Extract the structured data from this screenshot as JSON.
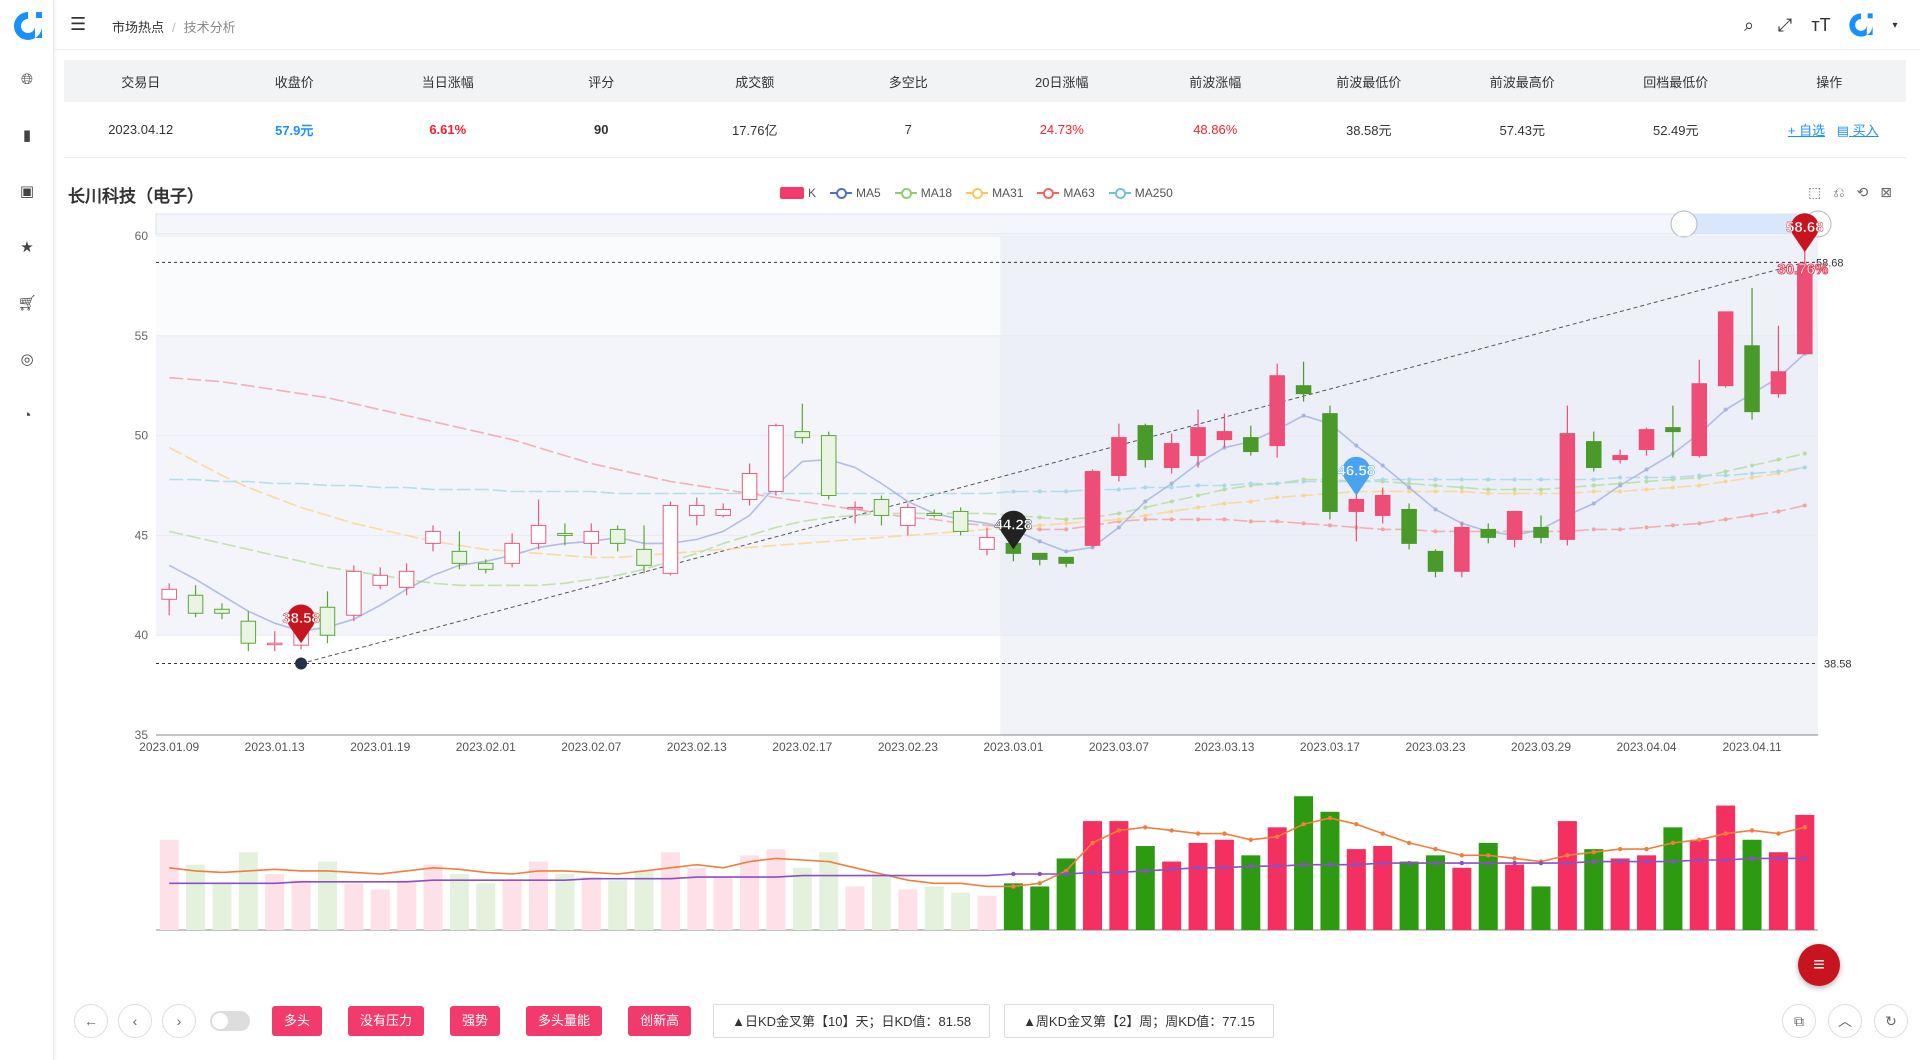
{
  "breadcrumb": {
    "root": "市场热点",
    "current": "技术分析"
  },
  "table": {
    "headers": [
      "交易日",
      "收盘价",
      "当日涨幅",
      "评分",
      "成交额",
      "多空比",
      "20日涨幅",
      "前波涨幅",
      "前波最低价",
      "前波最高价",
      "回档最低价",
      "操作"
    ],
    "row": [
      "2023.04.12",
      "57.9元",
      "6.61%",
      "90",
      "17.76亿",
      "7",
      "24.73%",
      "48.86%",
      "38.58元",
      "57.43元",
      "52.49元"
    ],
    "actions": {
      "watch": "+ 自选",
      "buy": "买入"
    }
  },
  "stock_title": "长川科技（电子）",
  "legend": [
    {
      "name": "K",
      "color": "#f23b6c"
    },
    {
      "name": "MA5",
      "color": "#5470c6"
    },
    {
      "name": "MA18",
      "color": "#91cc75"
    },
    {
      "name": "MA31",
      "color": "#fac858"
    },
    {
      "name": "MA63",
      "color": "#ee6666"
    },
    {
      "name": "MA250",
      "color": "#73c0de"
    }
  ],
  "chart_data": {
    "type": "candlestick",
    "ylim": [
      35,
      60
    ],
    "yticks": [
      "60",
      "55",
      "50",
      "45",
      "40",
      "35"
    ],
    "xticks": [
      "2023.01.09",
      "2023.01.13",
      "2023.01.19",
      "2023.02.01",
      "2023.02.07",
      "2023.02.13",
      "2023.02.17",
      "2023.02.23",
      "2023.03.01",
      "2023.03.07",
      "2023.03.13",
      "2023.03.17",
      "2023.03.23",
      "2023.03.29",
      "2023.04.04",
      "2023.04.11"
    ],
    "candles": [
      [
        41.8,
        42.3,
        41.0,
        42.6
      ],
      [
        42.0,
        41.1,
        40.9,
        42.5
      ],
      [
        41.3,
        41.1,
        40.8,
        41.6
      ],
      [
        40.7,
        39.6,
        39.2,
        41.2
      ],
      [
        39.6,
        39.6,
        39.2,
        40.2
      ],
      [
        39.5,
        40.8,
        39.3,
        41.3
      ],
      [
        41.4,
        40.0,
        39.6,
        42.2
      ],
      [
        41.0,
        43.2,
        40.7,
        43.5
      ],
      [
        42.5,
        43.0,
        42.3,
        43.4
      ],
      [
        42.4,
        43.2,
        42.0,
        43.6
      ],
      [
        44.6,
        45.2,
        44.2,
        45.5
      ],
      [
        44.2,
        43.6,
        43.3,
        45.2
      ],
      [
        43.6,
        43.3,
        43.1,
        43.8
      ],
      [
        43.6,
        44.6,
        43.4,
        45.1
      ],
      [
        44.6,
        45.5,
        44.3,
        46.8
      ],
      [
        45.1,
        45.0,
        44.5,
        45.6
      ],
      [
        44.6,
        45.2,
        44.0,
        45.6
      ],
      [
        45.3,
        44.6,
        44.2,
        45.5
      ],
      [
        44.3,
        43.5,
        43.1,
        45.5
      ],
      [
        43.1,
        46.5,
        43.0,
        46.7
      ],
      [
        46.0,
        46.5,
        45.5,
        46.9
      ],
      [
        46.0,
        46.3,
        45.9,
        46.6
      ],
      [
        46.8,
        48.1,
        46.5,
        48.6
      ],
      [
        47.2,
        50.5,
        47.0,
        50.6
      ],
      [
        50.2,
        49.9,
        49.6,
        51.6
      ],
      [
        50.0,
        47.0,
        46.8,
        50.2
      ],
      [
        46.4,
        46.4,
        45.6,
        46.7
      ],
      [
        46.8,
        46.0,
        45.5,
        47.0
      ],
      [
        45.5,
        46.4,
        45.0,
        46.6
      ],
      [
        46.1,
        46.0,
        45.9,
        46.3
      ],
      [
        46.2,
        45.2,
        45.0,
        46.4
      ],
      [
        44.3,
        44.9,
        44.0,
        45.4
      ],
      [
        44.6,
        44.1,
        43.7,
        44.6
      ],
      [
        44.1,
        43.8,
        43.5,
        44.1
      ],
      [
        43.9,
        43.6,
        43.4,
        43.9
      ],
      [
        44.5,
        48.2,
        44.4,
        48.3
      ],
      [
        48.0,
        49.9,
        47.7,
        50.6
      ],
      [
        50.5,
        48.8,
        48.4,
        50.6
      ],
      [
        48.4,
        49.6,
        48.1,
        50.1
      ],
      [
        49.0,
        50.4,
        48.4,
        51.3
      ],
      [
        49.8,
        50.2,
        49.4,
        51.1
      ],
      [
        49.9,
        49.2,
        49.0,
        50.5
      ],
      [
        49.5,
        53.0,
        48.9,
        53.6
      ],
      [
        52.5,
        52.1,
        51.7,
        53.7
      ],
      [
        51.1,
        46.2,
        45.8,
        51.5
      ],
      [
        46.2,
        46.8,
        44.7,
        47.1
      ],
      [
        46.0,
        47.0,
        45.6,
        47.4
      ],
      [
        46.3,
        44.6,
        44.3,
        46.6
      ],
      [
        44.2,
        43.2,
        42.9,
        44.3
      ],
      [
        43.2,
        45.4,
        42.9,
        45.6
      ],
      [
        45.3,
        44.9,
        44.6,
        45.6
      ],
      [
        44.8,
        46.2,
        44.4,
        46.2
      ],
      [
        45.4,
        44.9,
        44.6,
        46.0
      ],
      [
        44.8,
        50.1,
        44.5,
        51.5
      ],
      [
        49.7,
        48.4,
        48.2,
        50.2
      ],
      [
        48.8,
        49.0,
        48.6,
        49.3
      ],
      [
        49.3,
        50.3,
        49.0,
        50.4
      ],
      [
        50.4,
        50.2,
        48.9,
        51.5
      ],
      [
        49.0,
        52.6,
        48.9,
        53.8
      ],
      [
        52.5,
        56.2,
        52.4,
        56.2
      ],
      [
        54.5,
        51.2,
        50.8,
        57.4
      ],
      [
        52.1,
        53.2,
        51.9,
        55.5
      ],
      [
        54.1,
        58.5,
        54.1,
        60.0
      ]
    ],
    "ma5": [
      43.5,
      42.8,
      42.0,
      41.2,
      40.6,
      40.2,
      40.4,
      40.8,
      41.5,
      42.3,
      43.0,
      43.5,
      43.7,
      44.0,
      44.4,
      44.6,
      44.7,
      44.9,
      44.6,
      44.6,
      44.8,
      45.2,
      46.0,
      47.5,
      48.7,
      48.8,
      48.4,
      47.6,
      46.7,
      46.1,
      45.8,
      45.6,
      45.3,
      44.7,
      44.2,
      44.4,
      45.4,
      46.7,
      47.6,
      48.6,
      49.4,
      49.7,
      50.3,
      51.0,
      50.6,
      49.5,
      48.5,
      47.4,
      46.3,
      45.6,
      45.2,
      45.0,
      45.3,
      46.0,
      46.6,
      47.5,
      48.3,
      49.1,
      50.1,
      51.3,
      52.1,
      52.9,
      54.1
    ],
    "ma18": [
      45.2,
      44.9,
      44.6,
      44.3,
      44.0,
      43.7,
      43.4,
      43.2,
      43.0,
      42.8,
      42.6,
      42.5,
      42.5,
      42.5,
      42.5,
      42.6,
      42.8,
      43.0,
      43.3,
      43.7,
      44.1,
      44.6,
      45.0,
      45.4,
      45.7,
      45.9,
      46.0,
      46.1,
      46.1,
      46.1,
      46.1,
      46.1,
      46.0,
      45.9,
      45.8,
      45.9,
      46.1,
      46.4,
      46.7,
      47.0,
      47.3,
      47.5,
      47.6,
      47.8,
      47.8,
      47.7,
      47.7,
      47.6,
      47.5,
      47.4,
      47.3,
      47.3,
      47.3,
      47.4,
      47.5,
      47.6,
      47.7,
      47.8,
      47.9,
      48.2,
      48.5,
      48.8,
      49.1
    ],
    "ma31": [
      49.4,
      48.7,
      48.0,
      47.4,
      46.9,
      46.4,
      46.0,
      45.6,
      45.3,
      45.0,
      44.7,
      44.5,
      44.3,
      44.2,
      44.1,
      44.0,
      43.9,
      43.9,
      44.0,
      44.1,
      44.2,
      44.3,
      44.4,
      44.5,
      44.6,
      44.7,
      44.8,
      44.9,
      45.0,
      45.1,
      45.2,
      45.3,
      45.4,
      45.5,
      45.6,
      45.7,
      45.8,
      46.0,
      46.2,
      46.4,
      46.6,
      46.7,
      46.9,
      47.0,
      47.1,
      47.2,
      47.2,
      47.2,
      47.2,
      47.2,
      47.1,
      47.1,
      47.1,
      47.1,
      47.2,
      47.2,
      47.3,
      47.4,
      47.5,
      47.7,
      47.9,
      48.1,
      48.4
    ],
    "ma63": [
      52.9,
      52.8,
      52.7,
      52.5,
      52.3,
      52.1,
      51.9,
      51.6,
      51.3,
      51.0,
      50.7,
      50.4,
      50.1,
      49.8,
      49.4,
      49.0,
      48.6,
      48.3,
      48.0,
      47.7,
      47.5,
      47.3,
      47.1,
      46.9,
      46.7,
      46.5,
      46.3,
      46.1,
      45.9,
      45.8,
      45.6,
      45.5,
      45.4,
      45.3,
      45.3,
      45.5,
      45.7,
      45.8,
      45.8,
      45.8,
      45.8,
      45.7,
      45.7,
      45.6,
      45.5,
      45.4,
      45.3,
      45.3,
      45.2,
      45.2,
      45.2,
      45.2,
      45.2,
      45.2,
      45.3,
      45.3,
      45.4,
      45.5,
      45.6,
      45.8,
      46.0,
      46.2,
      46.5
    ],
    "ma250": [
      47.8,
      47.8,
      47.7,
      47.7,
      47.6,
      47.6,
      47.5,
      47.5,
      47.4,
      47.4,
      47.3,
      47.3,
      47.3,
      47.2,
      47.2,
      47.2,
      47.2,
      47.1,
      47.1,
      47.1,
      47.1,
      47.1,
      47.1,
      47.1,
      47.1,
      47.1,
      47.1,
      47.1,
      47.1,
      47.1,
      47.1,
      47.1,
      47.2,
      47.2,
      47.2,
      47.3,
      47.3,
      47.4,
      47.4,
      47.5,
      47.5,
      47.6,
      47.6,
      47.7,
      47.7,
      47.7,
      47.8,
      47.8,
      47.8,
      47.8,
      47.8,
      47.8,
      47.8,
      47.8,
      47.8,
      47.9,
      47.9,
      47.9,
      48.0,
      48.0,
      48.1,
      48.2,
      48.4
    ],
    "annotations": {
      "low_label": "38.58",
      "high_label": "58.68",
      "high_pct": "30.76%",
      "mid_label": "44.28",
      "peak_label": "46.58",
      "right_low": "38.58",
      "right_high": "58.68"
    },
    "volume": [
      58,
      42,
      30,
      50,
      36,
      32,
      44,
      30,
      26,
      32,
      42,
      36,
      30,
      32,
      44,
      36,
      34,
      32,
      38,
      50,
      40,
      34,
      48,
      52,
      40,
      50,
      28,
      36,
      26,
      28,
      24,
      22,
      30,
      28,
      46,
      70,
      70,
      54,
      44,
      56,
      58,
      48,
      66,
      86,
      76,
      52,
      54,
      44,
      48,
      40,
      56,
      42,
      28,
      70,
      52,
      46,
      48,
      66,
      58,
      80,
      58,
      50,
      74
    ],
    "vol_ma1": [
      40,
      38,
      37,
      38,
      39,
      38,
      38,
      37,
      36,
      38,
      40,
      39,
      37,
      36,
      38,
      38,
      37,
      36,
      38,
      40,
      42,
      40,
      44,
      46,
      45,
      44,
      40,
      36,
      32,
      30,
      30,
      28,
      28,
      30,
      38,
      56,
      64,
      66,
      64,
      62,
      62,
      58,
      60,
      68,
      72,
      68,
      62,
      56,
      52,
      48,
      48,
      46,
      44,
      48,
      50,
      52,
      52,
      56,
      58,
      62,
      64,
      62,
      66
    ],
    "vol_ma2": [
      30,
      30,
      30,
      30,
      30,
      31,
      31,
      31,
      31,
      31,
      32,
      32,
      32,
      32,
      32,
      32,
      33,
      33,
      33,
      33,
      34,
      34,
      34,
      34,
      35,
      35,
      35,
      35,
      35,
      35,
      35,
      35,
      36,
      36,
      36,
      37,
      37,
      38,
      39,
      40,
      40,
      41,
      41,
      42,
      42,
      42,
      43,
      43,
      43,
      43,
      43,
      43,
      43,
      43,
      44,
      44,
      44,
      44,
      45,
      45,
      46,
      46,
      46
    ]
  },
  "bottom": {
    "tags": [
      "多头",
      "没有压力",
      "强势",
      "多头量能",
      "创新高"
    ],
    "info1": "▲日KD金叉第【10】天；日KD值：81.58",
    "info2": "▲周KD金叉第【2】周；周KD值：77.15"
  }
}
